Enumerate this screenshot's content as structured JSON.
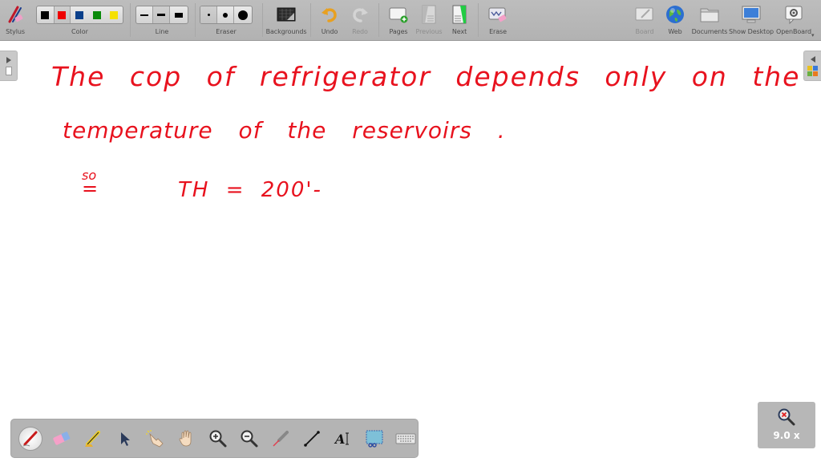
{
  "toolbar": {
    "stylus_label": "Stylus",
    "color_label": "Color",
    "line_label": "Line",
    "eraser_label": "Eraser",
    "backgrounds_label": "Backgrounds",
    "undo_label": "Undo",
    "redo_label": "Redo",
    "pages_label": "Pages",
    "previous_label": "Previous",
    "next_label": "Next",
    "erase_label": "Erase",
    "board_label": "Board",
    "web_label": "Web",
    "documents_label": "Documents",
    "show_desktop_label": "Show Desktop",
    "openboard_label": "OpenBoard",
    "colors": [
      {
        "name": "black",
        "hex": "#000000"
      },
      {
        "name": "red",
        "hex": "#ee0000"
      },
      {
        "name": "blue",
        "hex": "#0a3f8a"
      },
      {
        "name": "green",
        "hex": "#0a8a0a"
      },
      {
        "name": "yellow",
        "hex": "#f5e000"
      }
    ],
    "selected_color": "red",
    "line_widths": [
      "thin",
      "medium",
      "thick"
    ],
    "selected_line": "medium",
    "eraser_sizes": [
      "small",
      "medium",
      "large"
    ],
    "selected_eraser": "small"
  },
  "board": {
    "ink_color": "#e8121e",
    "lines": [
      "The cop of refrigerator depends only on the",
      "temperature of the reservoirs .",
      "so",
      "=",
      "TH = 200'-"
    ]
  },
  "bottom_tools": [
    {
      "name": "pen",
      "active": true
    },
    {
      "name": "eraser"
    },
    {
      "name": "highlighter"
    },
    {
      "name": "selector"
    },
    {
      "name": "interact"
    },
    {
      "name": "hand"
    },
    {
      "name": "zoom-in"
    },
    {
      "name": "zoom-out"
    },
    {
      "name": "laser-pointer"
    },
    {
      "name": "line"
    },
    {
      "name": "text"
    },
    {
      "name": "capture"
    },
    {
      "name": "keyboard"
    }
  ],
  "zoom": {
    "level": "9.0 x"
  }
}
